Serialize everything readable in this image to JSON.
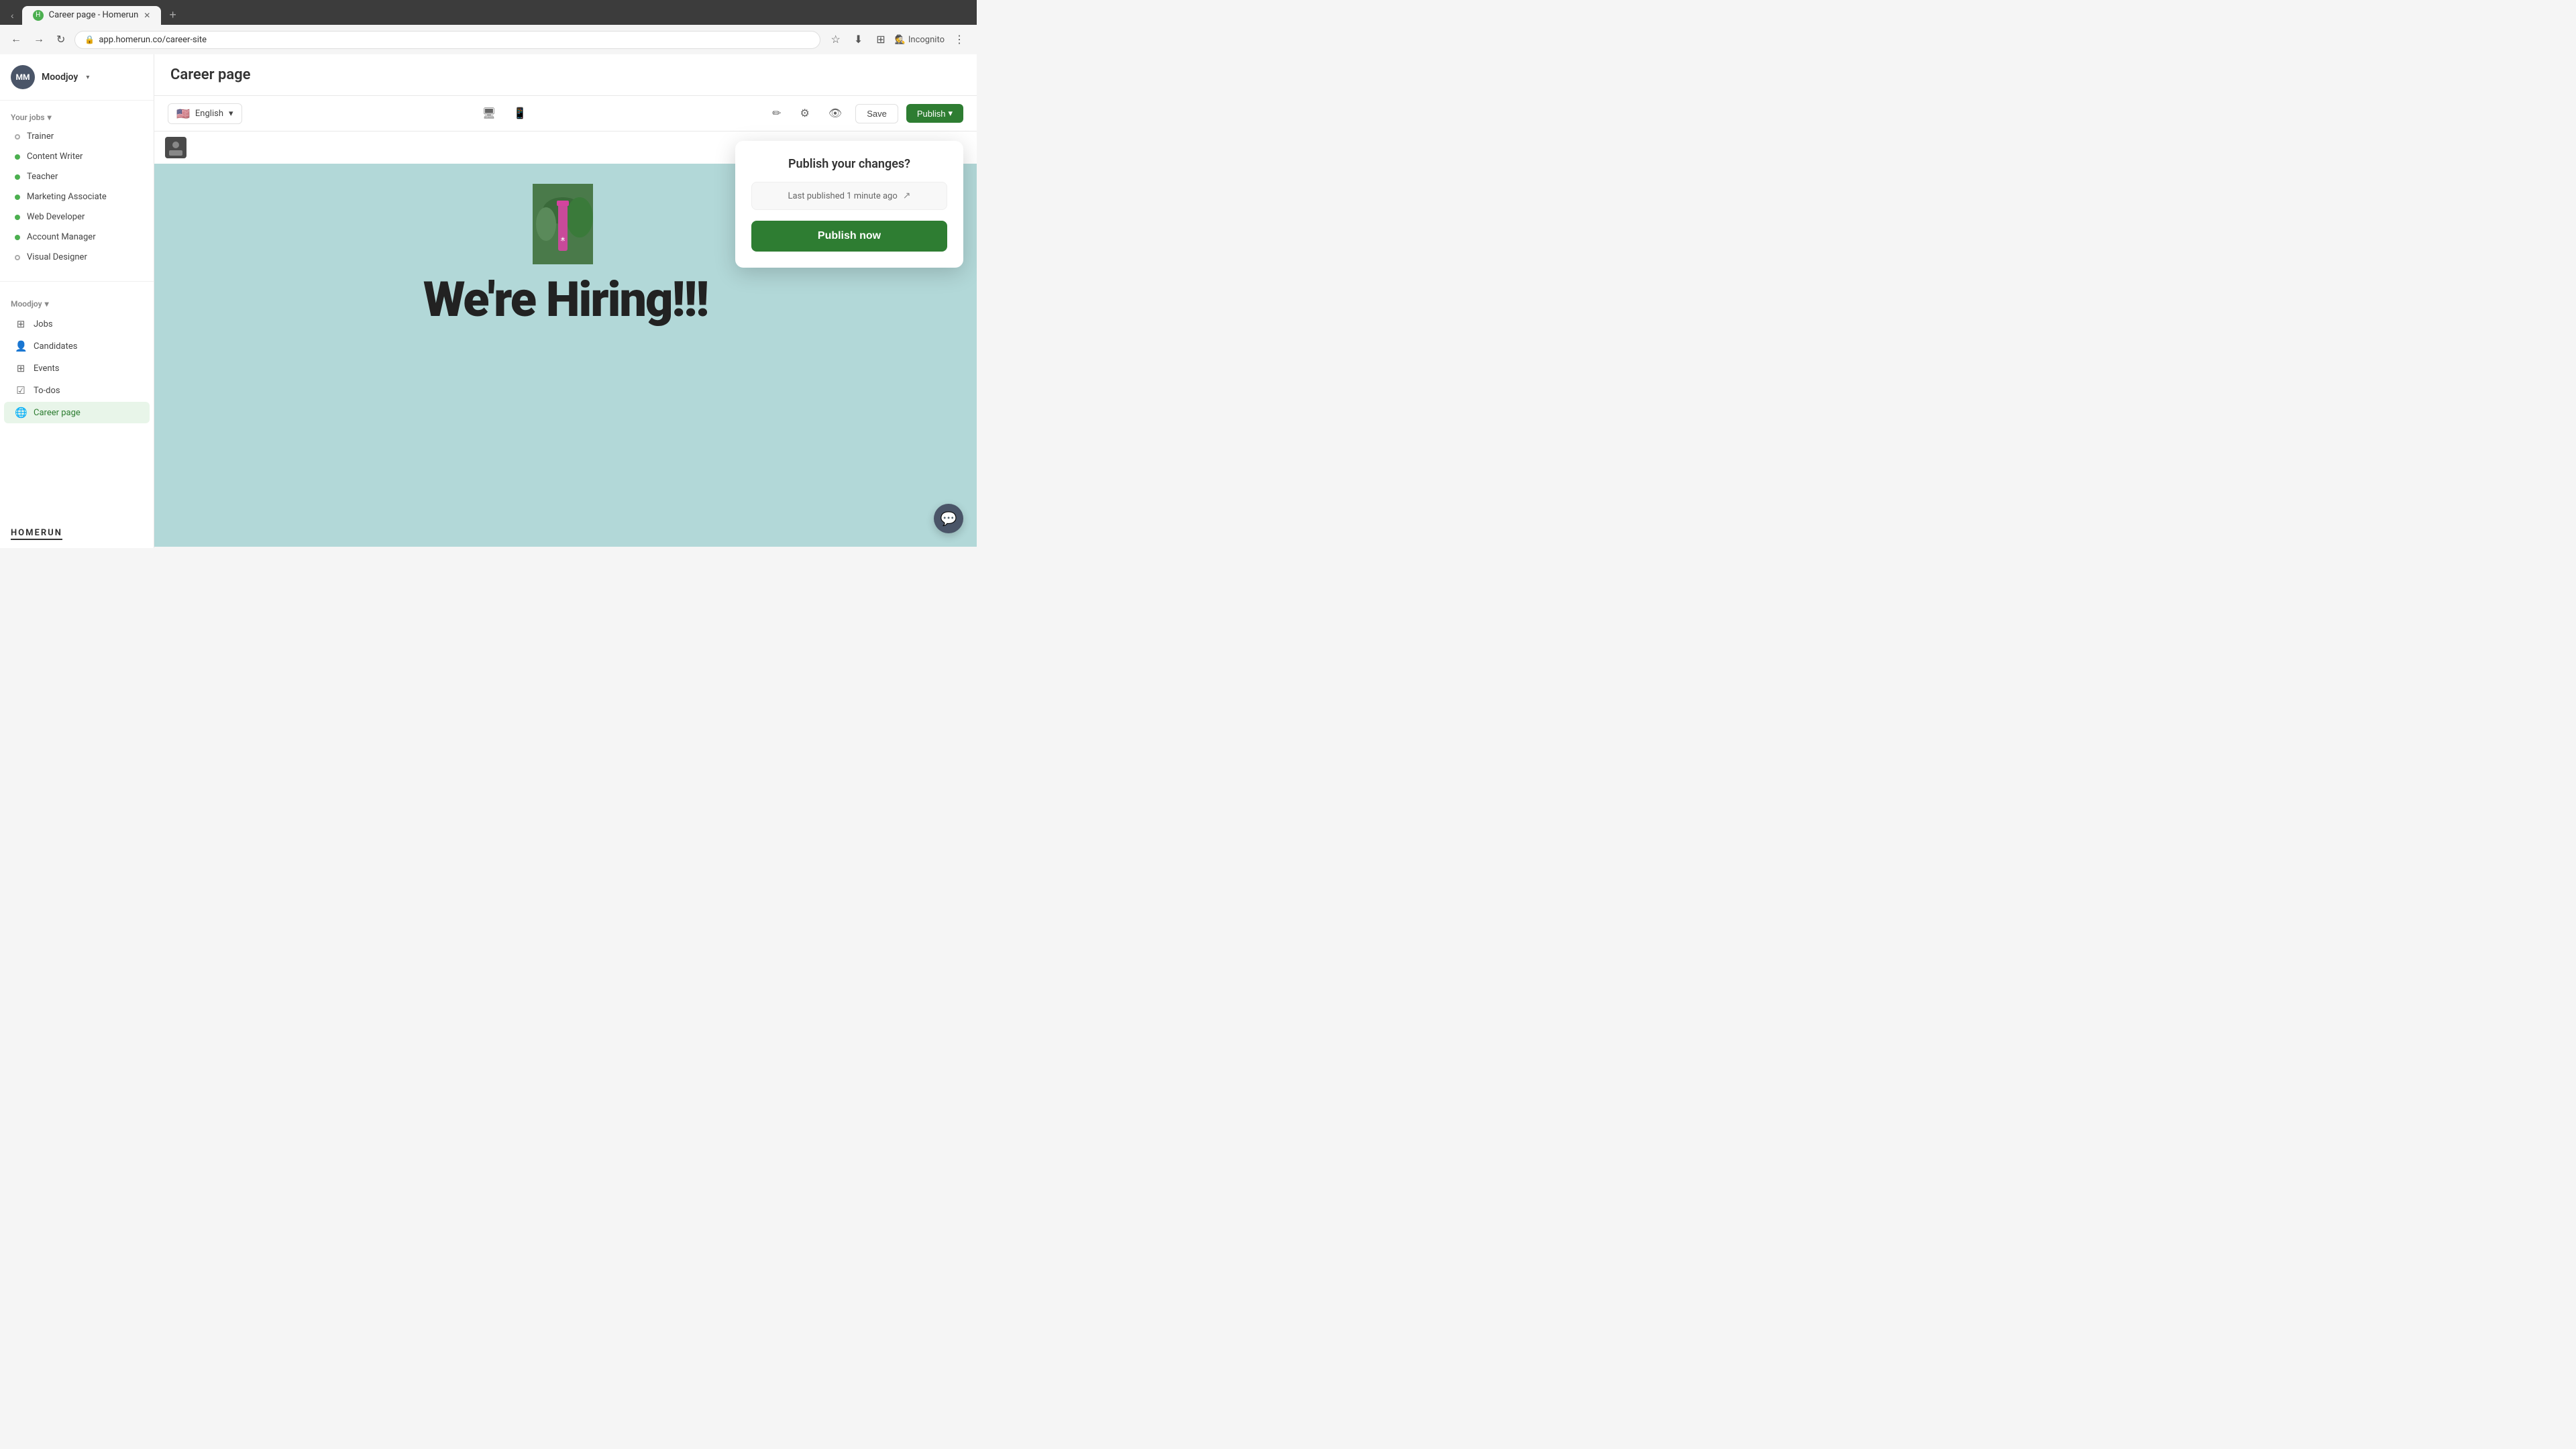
{
  "browser": {
    "tab_label": "Career page - Homerun",
    "tab_favicon": "H",
    "url": "app.homerun.co/career-site",
    "incognito_label": "Incognito"
  },
  "sidebar": {
    "user_initials": "MM",
    "company_name": "Moodjoy",
    "your_jobs_label": "Your jobs",
    "jobs": [
      {
        "name": "Trainer",
        "status": "outline"
      },
      {
        "name": "Content Writer",
        "status": "green"
      },
      {
        "name": "Teacher",
        "status": "green"
      },
      {
        "name": "Marketing Associate",
        "status": "green"
      },
      {
        "name": "Web Developer",
        "status": "green"
      },
      {
        "name": "Account Manager",
        "status": "green"
      },
      {
        "name": "Visual Designer",
        "status": "outline"
      }
    ],
    "company_section_label": "Moodjoy",
    "nav_items": [
      {
        "label": "Jobs",
        "icon": "⊞"
      },
      {
        "label": "Candidates",
        "icon": "👤"
      },
      {
        "label": "Events",
        "icon": "⊞"
      },
      {
        "label": "To-dos",
        "icon": "☑"
      },
      {
        "label": "Career page",
        "icon": "🌐",
        "active": true
      }
    ],
    "logo_text": "HOMERUN"
  },
  "main": {
    "page_title": "Career page"
  },
  "preview_toolbar": {
    "language_label": "English",
    "flag_emoji": "🇺🇸",
    "save_label": "Save",
    "publish_label": "Publish"
  },
  "preview": {
    "hiring_text": "We're Hiring!!!",
    "image_alt": "nature photo"
  },
  "publish_popup": {
    "title": "Publish your changes?",
    "last_published_label": "Last published 1 minute ago",
    "publish_now_label": "Publish now"
  },
  "icons": {
    "desktop": "🖥",
    "mobile": "📱",
    "pen": "✏",
    "gear": "⚙",
    "eye": "👁",
    "external_link": "↗",
    "chat": "💬",
    "chevron_down": "▾",
    "back": "←",
    "forward": "→",
    "reload": "↻",
    "star": "☆",
    "download": "⬇",
    "extensions": "⊞",
    "more": "⋮"
  }
}
